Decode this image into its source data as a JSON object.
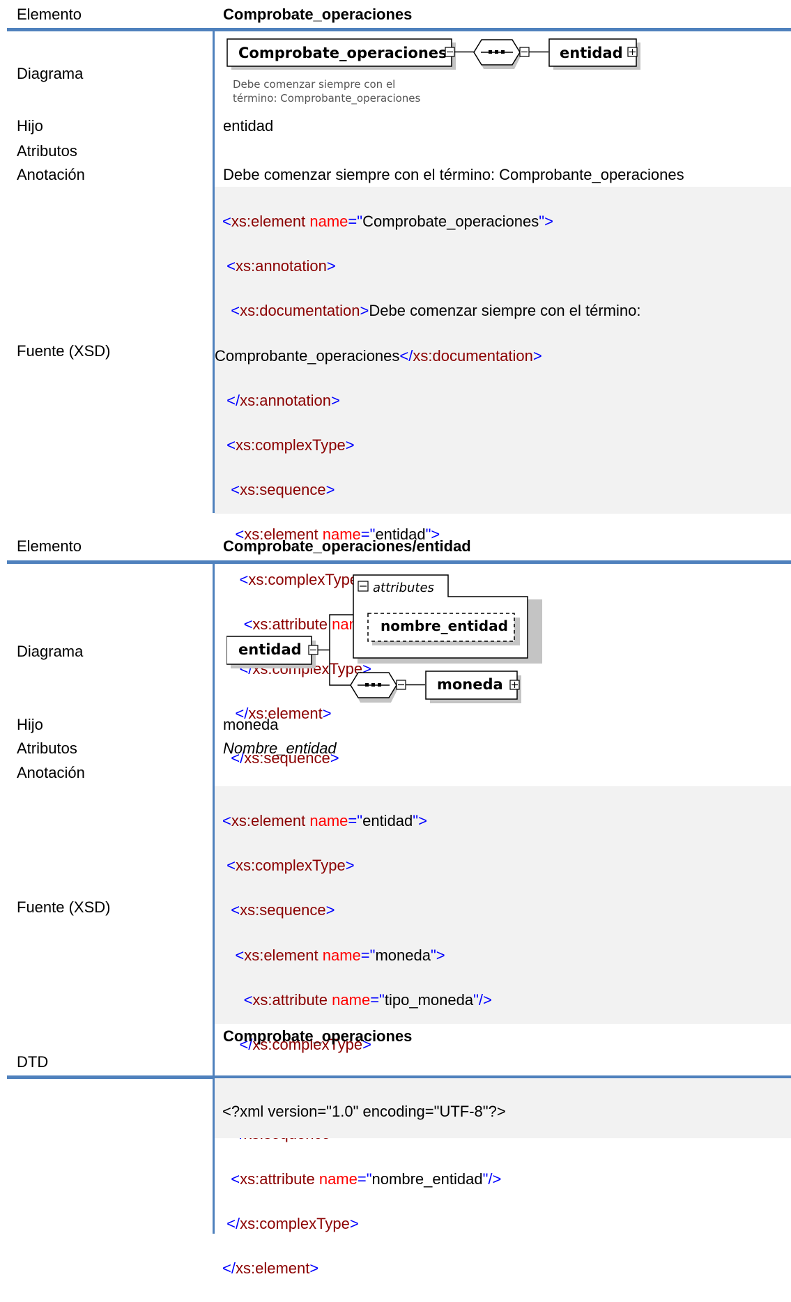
{
  "section1": {
    "header_label": "Elemento",
    "header_value": "Comprobate_operaciones",
    "labels": {
      "diagram": "Diagrama",
      "child": "Hijo",
      "attributes": "Atributos",
      "annotation": "Anotación",
      "source": "Fuente (XSD)"
    },
    "diagram": {
      "root_box": "Comprobate_operaciones",
      "child_box": "entidad",
      "note_line1": "Debe comenzar siempre con el",
      "note_line2": "término: Comprobante_operaciones"
    },
    "child": "entidad",
    "attributes": "",
    "annotation": "Debe comenzar siempre con el término: Comprobante_operaciones",
    "code": {
      "l1_name": "Comprobate_operaciones",
      "l3_doc": "Debe comenzar siempre con el término:",
      "l4_doc": "Comprobante_operaciones",
      "l8_name": "entidad",
      "l10_name": "nombre_entidad"
    }
  },
  "section2": {
    "header_label": "Elemento",
    "header_value": "Comprobate_operaciones/entidad",
    "labels": {
      "diagram": "Diagrama",
      "child": "Hijo",
      "attributes": "Atributos",
      "annotation": "Anotación",
      "source": "Fuente (XSD)"
    },
    "diagram": {
      "attributes_label": "attributes",
      "attr_box": "nombre_entidad",
      "root_box": "entidad",
      "child_box": "moneda"
    },
    "child": "moneda",
    "attributes": "Nombre_entidad",
    "code": {
      "l1_name": "entidad",
      "l4_name": "moneda",
      "l5_name": "tipo_moneda",
      "l9_name": "nombre_entidad"
    }
  },
  "section3": {
    "title": "Comprobate_operaciones",
    "label": "DTD",
    "code_line": "<?xml version=\"1.0\" encoding=\"UTF-8\"?>"
  },
  "xml": {
    "element": "xs:element",
    "annotation": "xs:annotation",
    "documentation": "xs:documentation",
    "complexType": "xs:complexType",
    "sequence": "xs:sequence",
    "attribute": "xs:attribute",
    "name_attr": "name"
  },
  "colors": {
    "accent": "#4f81bd",
    "tag": "#0000ff",
    "element": "#8b0000",
    "attr": "#ff0000",
    "code_bg": "#f2f2f2"
  }
}
